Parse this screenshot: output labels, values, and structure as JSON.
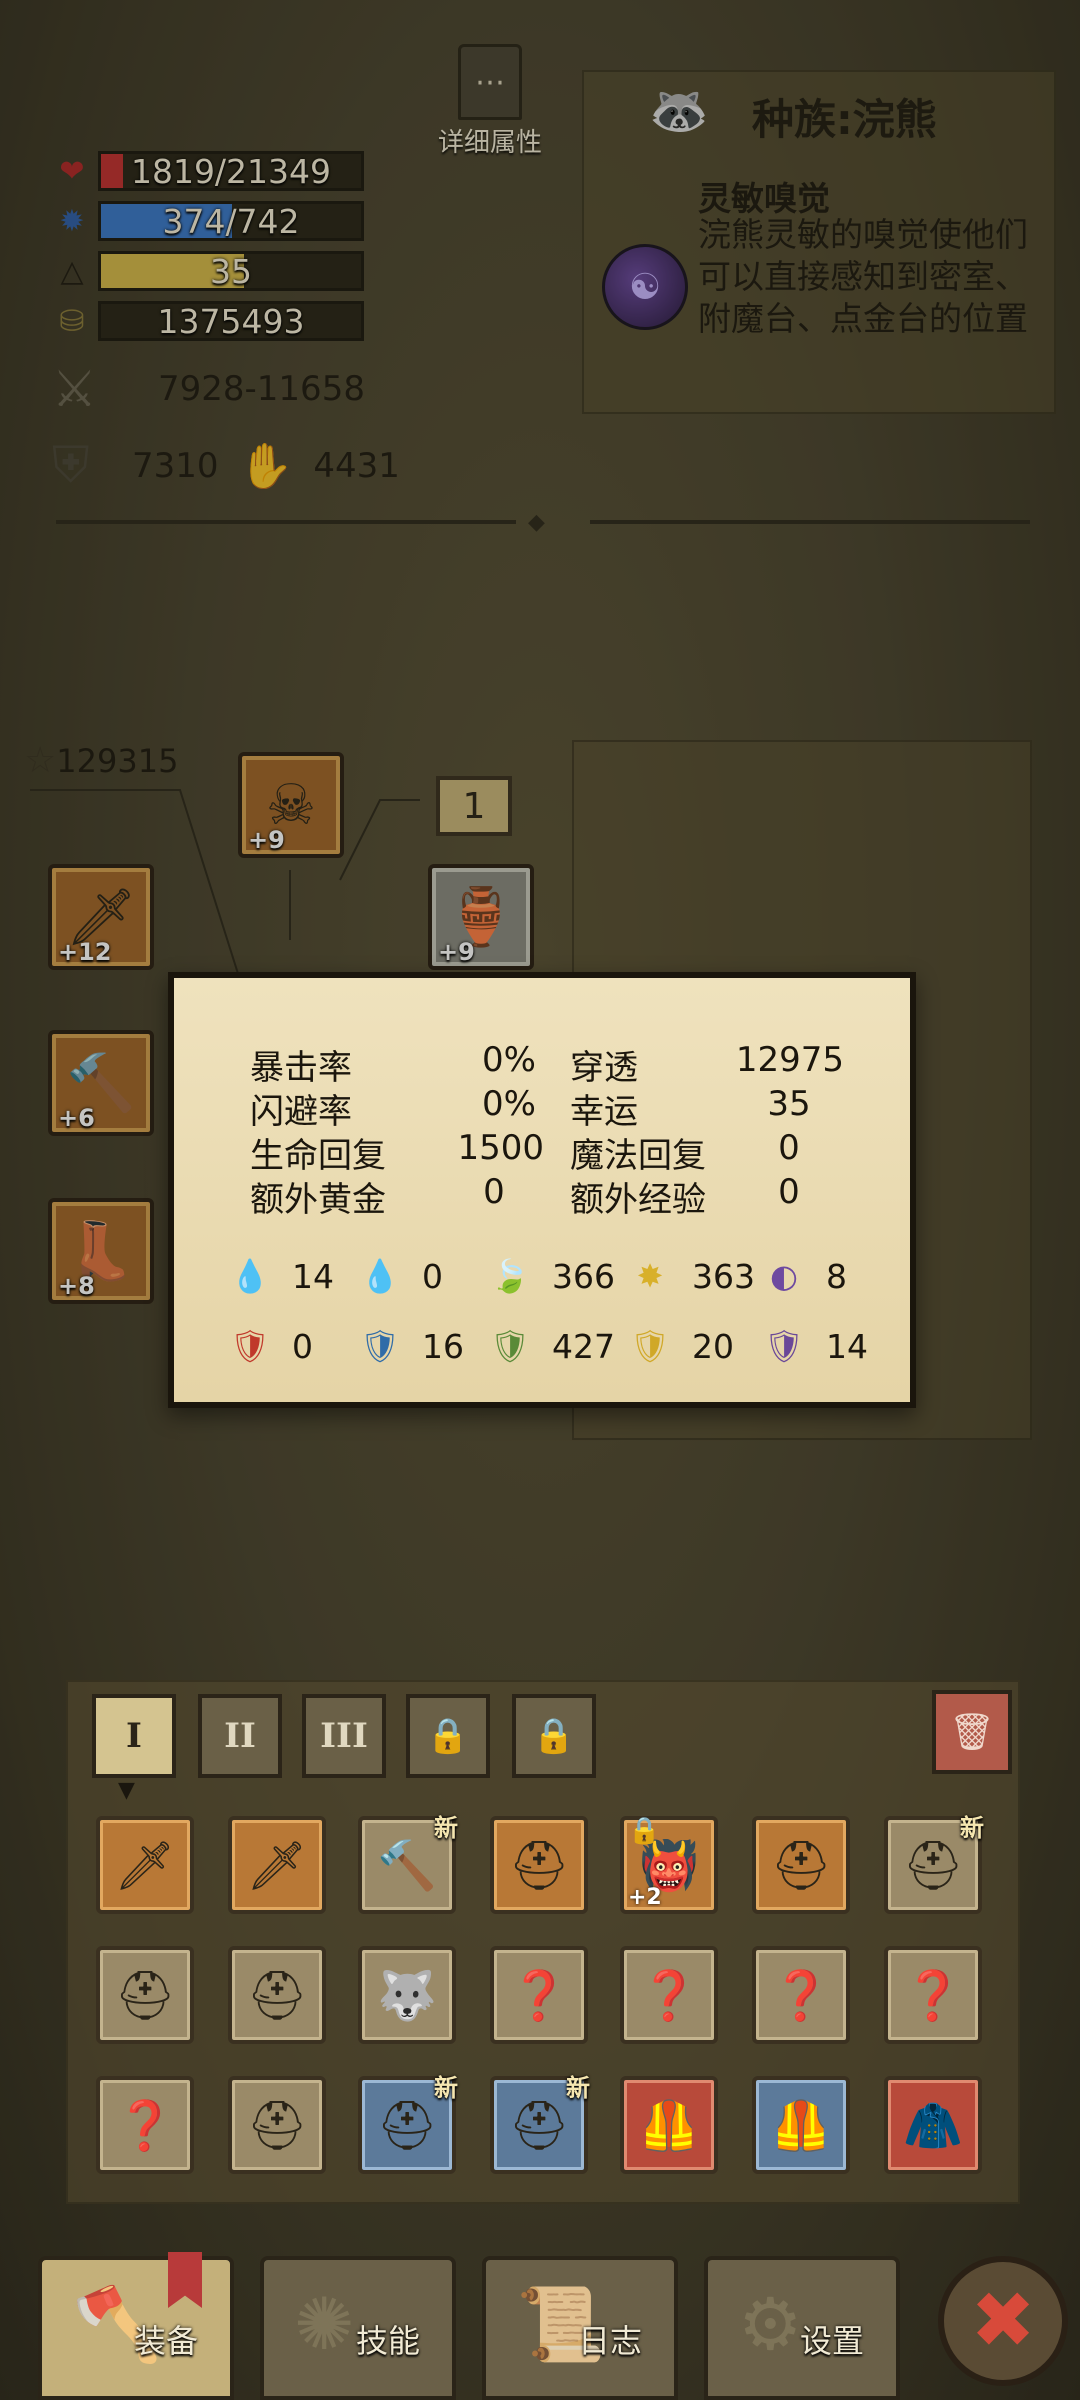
{
  "detail_button": {
    "label": "详细属性"
  },
  "stats": {
    "hp": {
      "text": "1819/21349",
      "fraction": 0.085,
      "color": "#c03030"
    },
    "mp": {
      "text": "374/742",
      "fraction": 0.504,
      "color": "#3a78c8"
    },
    "level": {
      "text": "35",
      "fraction": 0.55,
      "color": "#d4b84a"
    },
    "gold": {
      "text": "1375493"
    },
    "damage": "7928-11658",
    "defense": "7310",
    "magic_power": "4431"
  },
  "race": {
    "title": "种族:浣熊",
    "skill_name": "灵敏嗅觉",
    "skill_desc": "浣熊灵敏的嗅觉使他们可以直接感知到密室、附魔台、点金台的位置"
  },
  "equipment": {
    "score": "129315",
    "slot_levels": [
      "+9",
      "+12",
      "+9",
      "+6",
      "+8"
    ],
    "count_box": "1"
  },
  "popup": {
    "crit_label": "暴击率",
    "crit_value": "0%",
    "pierce_label": "穿透",
    "pierce_value": "12975",
    "dodge_label": "闪避率",
    "dodge_value": "0%",
    "luck_label": "幸运",
    "luck_value": "35",
    "hpregen_label": "生命回复",
    "hpregen_value": "1500",
    "mpregen_label": "魔法回复",
    "mpregen_value": "0",
    "gold_label": "额外黄金",
    "gold_value": "0",
    "exp_label": "额外经验",
    "exp_value": "0",
    "attack_elements": [
      "14",
      "0",
      "366",
      "363",
      "8"
    ],
    "resist_elements": [
      "0",
      "16",
      "427",
      "20",
      "14"
    ]
  },
  "inventory": {
    "tabs": [
      "I",
      "II",
      "III"
    ],
    "new_badge": "新",
    "plus_badge": "+2"
  },
  "nav": {
    "equip": "装备",
    "skills": "技能",
    "log": "日志",
    "settings": "设置"
  }
}
